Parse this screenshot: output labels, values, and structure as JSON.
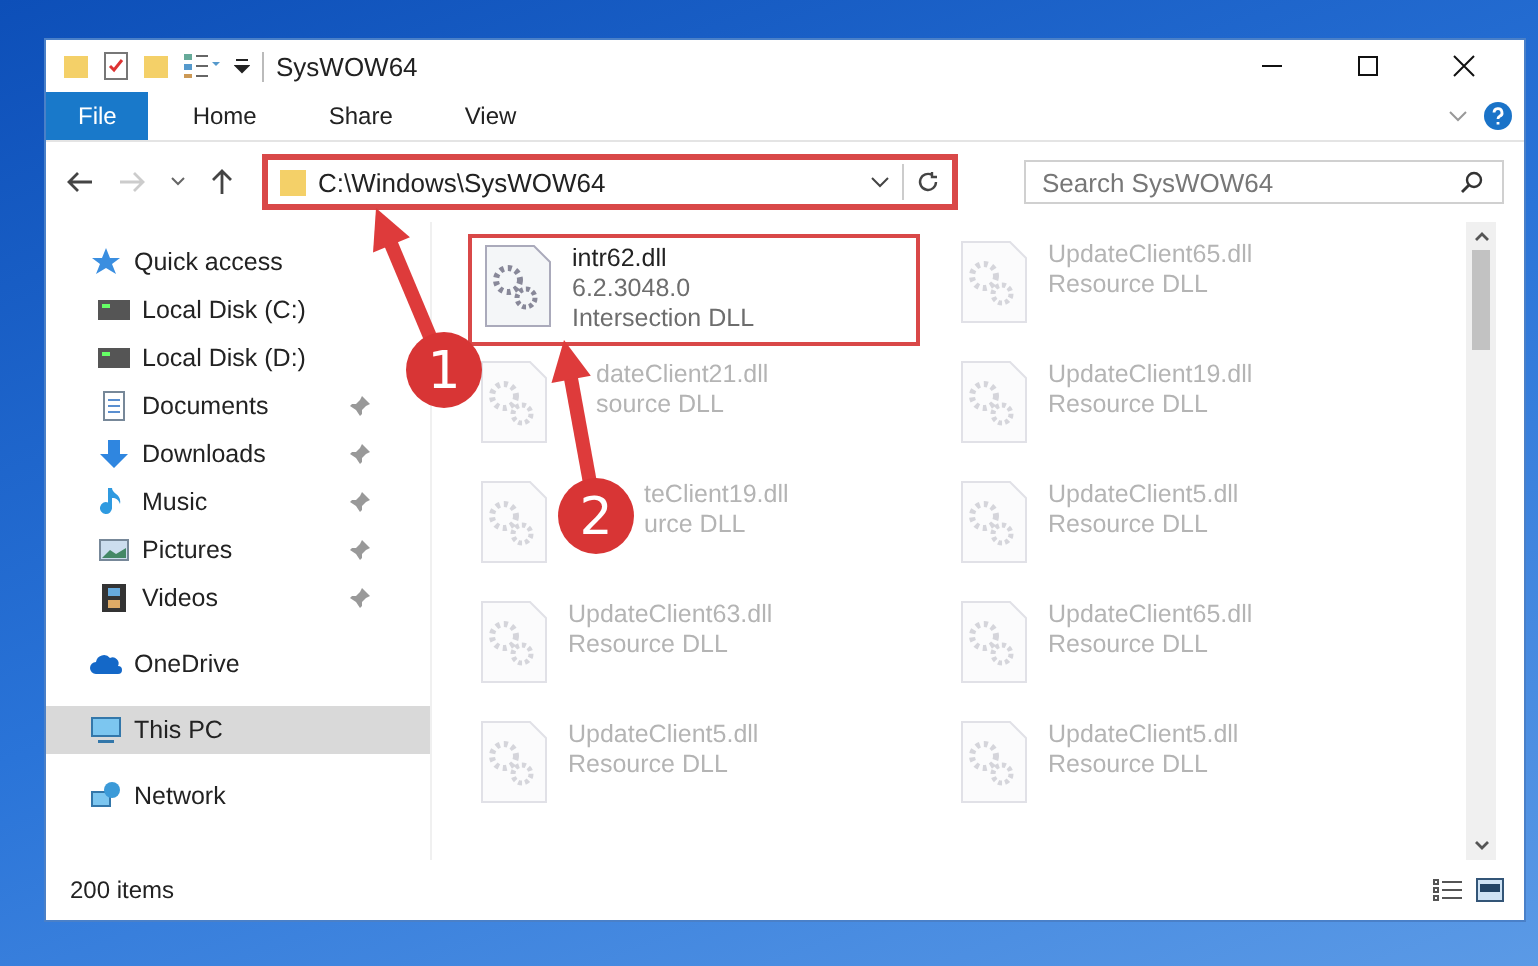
{
  "window": {
    "title": "SysWOW64"
  },
  "ribbon": {
    "tabs": [
      {
        "label": "File",
        "selected": true
      },
      {
        "label": "Home",
        "selected": false
      },
      {
        "label": "Share",
        "selected": false
      },
      {
        "label": "View",
        "selected": false
      }
    ]
  },
  "address": {
    "path": "C:\\Windows\\SysWOW64",
    "highlighted": true
  },
  "search": {
    "placeholder": "Search SysWOW64"
  },
  "sidebar": {
    "items": [
      {
        "label": "Quick access",
        "kind": "section",
        "pinned": false,
        "selected": false
      },
      {
        "label": "Local Disk (C:)",
        "kind": "item",
        "pinned": false,
        "selected": false
      },
      {
        "label": "Local Disk (D:)",
        "kind": "item",
        "pinned": false,
        "selected": false
      },
      {
        "label": "Documents",
        "kind": "item",
        "pinned": true,
        "selected": false
      },
      {
        "label": "Downloads",
        "kind": "item",
        "pinned": true,
        "selected": false
      },
      {
        "label": "Music",
        "kind": "item",
        "pinned": true,
        "selected": false
      },
      {
        "label": "Pictures",
        "kind": "item",
        "pinned": true,
        "selected": false
      },
      {
        "label": "Videos",
        "kind": "item",
        "pinned": true,
        "selected": false
      },
      {
        "label": "OneDrive",
        "kind": "section",
        "pinned": false,
        "selected": false
      },
      {
        "label": "This PC",
        "kind": "section",
        "pinned": false,
        "selected": true
      },
      {
        "label": "Network",
        "kind": "section",
        "pinned": false,
        "selected": false
      }
    ]
  },
  "files": [
    {
      "name": "intr62.dll",
      "lines": [
        "6.2.3048.0",
        "Intersection DLL"
      ],
      "highlighted": true,
      "dimmed": false
    },
    {
      "name": "UpdateClient65.dll",
      "lines": [
        "Resource DLL"
      ],
      "highlighted": false,
      "dimmed": true
    },
    {
      "name": "dateClient21.dll",
      "lines": [
        "source DLL"
      ],
      "highlighted": false,
      "dimmed": true,
      "kind": "under_arrow"
    },
    {
      "name": "UpdateClient19.dll",
      "lines": [
        "Resource DLL"
      ],
      "highlighted": false,
      "dimmed": true
    },
    {
      "name": "teClient19.dll",
      "lines": [
        "urce DLL"
      ],
      "highlighted": false,
      "dimmed": true,
      "kind": "under_badge"
    },
    {
      "name": "UpdateClient5.dll",
      "lines": [
        "Resource DLL"
      ],
      "highlighted": false,
      "dimmed": true
    },
    {
      "name": "UpdateClient63.dll",
      "lines": [
        "Resource DLL"
      ],
      "highlighted": false,
      "dimmed": true
    },
    {
      "name": "UpdateClient65.dll",
      "lines": [
        "Resource DLL"
      ],
      "highlighted": false,
      "dimmed": true
    },
    {
      "name": "UpdateClient5.dll",
      "lines": [
        "Resource DLL"
      ],
      "highlighted": false,
      "dimmed": true
    },
    {
      "name": "UpdateClient5.dll",
      "lines": [
        "Resource DLL"
      ],
      "highlighted": false,
      "dimmed": true
    }
  ],
  "status_bar": {
    "count": "200 items"
  },
  "annotations": [
    {
      "label": "1"
    },
    {
      "label": "2"
    }
  ]
}
